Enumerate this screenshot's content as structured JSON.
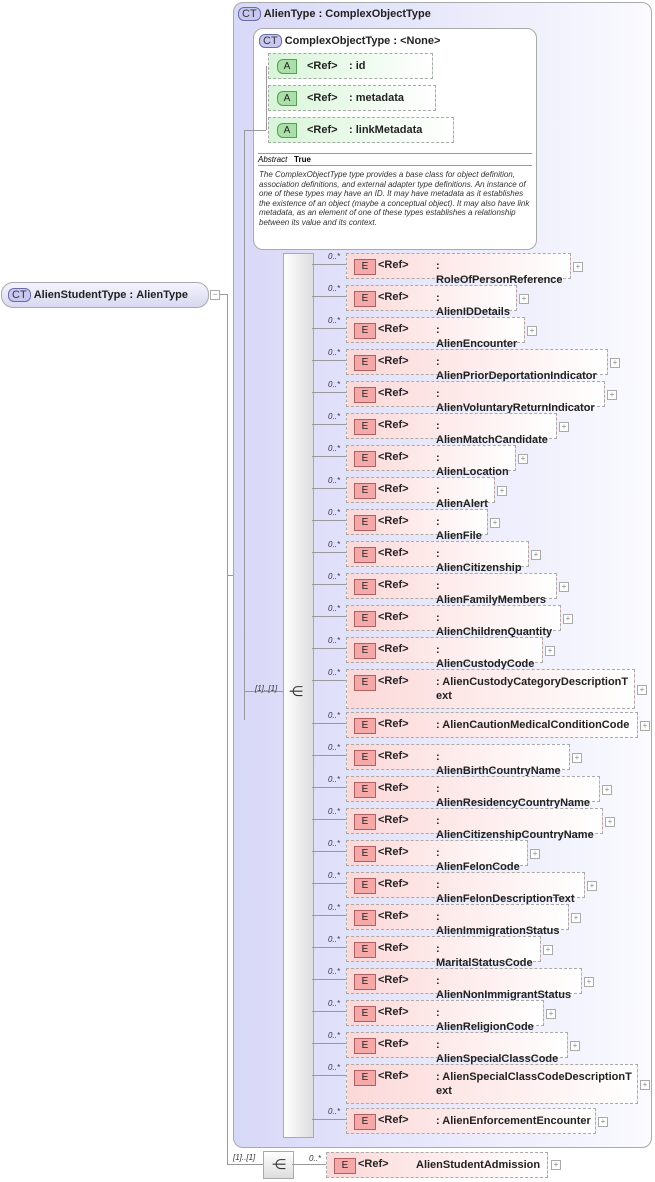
{
  "root": {
    "badge": "CT",
    "name": "AlienStudentType",
    "type": "AlienType"
  },
  "base": {
    "badge": "CT",
    "name": "AlienType",
    "type": "ComplexObjectType"
  },
  "complex": {
    "badge": "CT",
    "name": "ComplexObjectType",
    "type": "<None>",
    "attributes": [
      {
        "badge": "A",
        "ref": "<Ref>",
        "name": ": id"
      },
      {
        "badge": "A",
        "ref": "<Ref>",
        "name": ": metadata"
      },
      {
        "badge": "A",
        "ref": "<Ref>",
        "name": ": linkMetadata"
      }
    ],
    "abstract_label": "Abstract",
    "abstract_value": "True",
    "description": "The ComplexObjectType type provides a base class for object definition, association definitions, and external adapter type definitions. An instance of one of these types may have an ID. It may have metadata as it establishes the existence of an object (maybe a conceptual object). It may also have link metadata, as an element of one of these types establishes a relationship between its value and its context."
  },
  "sequence_cardinality": "[1]..[1]",
  "elements": [
    {
      "name": "RoleOfPersonReference"
    },
    {
      "name": "AlienIDDetails"
    },
    {
      "name": "AlienEncounter"
    },
    {
      "name": "AlienPriorDeportationIndicator"
    },
    {
      "name": "AlienVoluntaryReturnIndicator"
    },
    {
      "name": "AlienMatchCandidate"
    },
    {
      "name": "AlienLocation"
    },
    {
      "name": "AlienAlert"
    },
    {
      "name": "AlienFile"
    },
    {
      "name": "AlienCitizenship"
    },
    {
      "name": "AlienFamilyMembers"
    },
    {
      "name": "AlienChildrenQuantity"
    },
    {
      "name": "AlienCustodyCode"
    },
    {
      "name": "AlienCustodyCategoryDescriptionText"
    },
    {
      "name": "AlienCautionMedicalConditionCode"
    },
    {
      "name": "AlienBirthCountryName"
    },
    {
      "name": "AlienResidencyCountryName"
    },
    {
      "name": "AlienCitizenshipCountryName"
    },
    {
      "name": "AlienFelonCode"
    },
    {
      "name": "AlienFelonDescriptionText"
    },
    {
      "name": "AlienImmigrationStatus"
    },
    {
      "name": "MaritalStatusCode"
    },
    {
      "name": "AlienNonImmigrantStatus"
    },
    {
      "name": "AlienReligionCode"
    },
    {
      "name": "AlienSpecialClassCode"
    },
    {
      "name": "AlienSpecialClassCodeDescriptionText"
    },
    {
      "name": "AlienEnforcementEncounter"
    }
  ],
  "element_badge": "E",
  "element_ref": "<Ref>",
  "element_cardinality": "0..*",
  "outer_sequence_cardinality": "[1]..[1]",
  "admission": {
    "name": "AlienStudentAdmission",
    "cardinality": "0..*"
  }
}
